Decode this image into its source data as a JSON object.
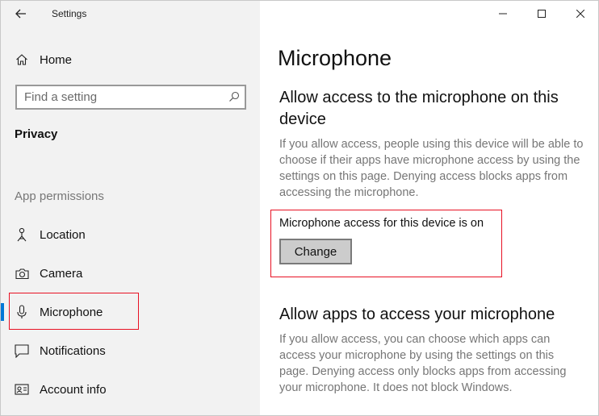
{
  "window": {
    "title": "Settings",
    "controls": [
      "minimize",
      "maximize",
      "close"
    ]
  },
  "sidebar": {
    "home_label": "Home",
    "search": {
      "placeholder": "Find a setting"
    },
    "section_header": "Privacy",
    "group_label": "App permissions",
    "items": [
      {
        "label": "Location",
        "icon": "location-icon"
      },
      {
        "label": "Camera",
        "icon": "camera-icon"
      },
      {
        "label": "Microphone",
        "icon": "microphone-icon",
        "selected": true
      },
      {
        "label": "Notifications",
        "icon": "notifications-icon"
      },
      {
        "label": "Account info",
        "icon": "account-info-icon"
      }
    ]
  },
  "main": {
    "page_title": "Microphone",
    "section1": {
      "heading": "Allow access to the microphone on this device",
      "description": "If you allow access, people using this device will be able to choose if their apps have microphone access by using the settings on this page. Denying access blocks apps from accessing the microphone.",
      "status": "Microphone access for this device is on",
      "button_label": "Change"
    },
    "section2": {
      "heading": "Allow apps to access your microphone",
      "description": "If you allow access, you can choose which apps can access your microphone by using the settings on this page. Denying access only blocks apps from accessing your microphone. It does not block Windows."
    }
  },
  "colors": {
    "accent": "#0078d7",
    "highlight_red": "#e81123",
    "sidebar_bg": "#f2f2f2"
  }
}
